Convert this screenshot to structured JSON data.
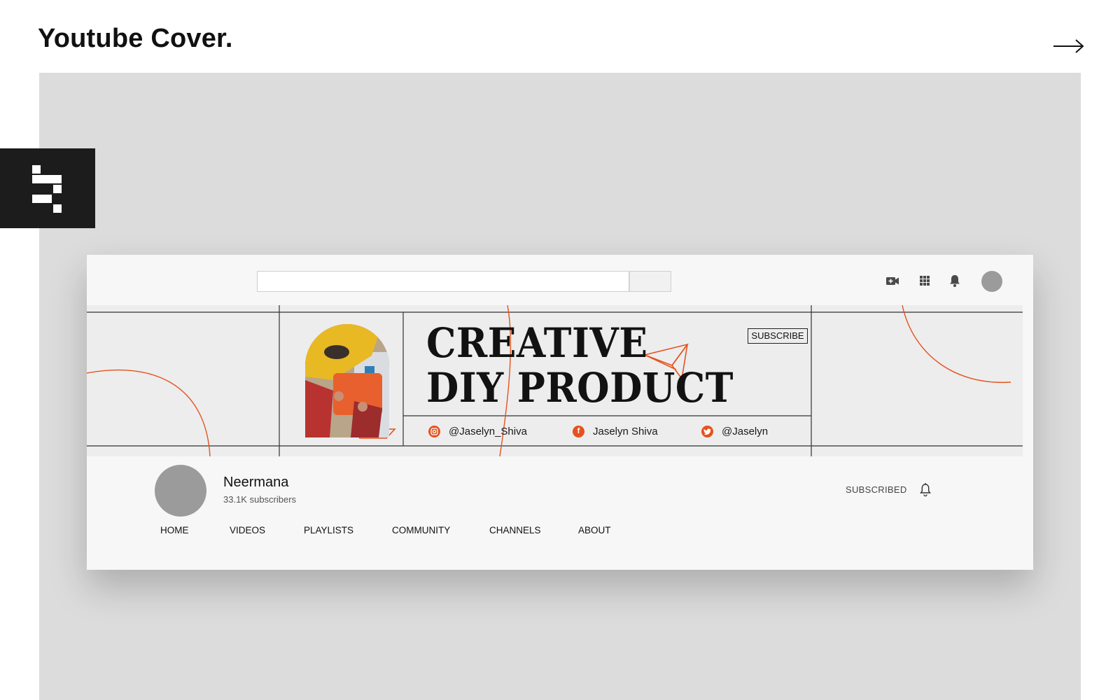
{
  "page": {
    "title": "Youtube Cover."
  },
  "brand": {
    "logo_icon": "pixel-logo-icon"
  },
  "youtube": {
    "search": {
      "placeholder": ""
    },
    "top_icons": [
      "video-camera-plus-icon",
      "apps-grid-icon",
      "notification-bell-icon"
    ],
    "banner": {
      "title_line1": "CREATIVE",
      "title_line2": "DIY PRODUCT",
      "subscribe_badge": "SUBSCRIBE",
      "socials": [
        {
          "platform": "instagram",
          "icon": "instagram-icon",
          "handle": "@Jaselyn_Shiva"
        },
        {
          "platform": "facebook",
          "icon": "facebook-icon",
          "handle": "Jaselyn Shiva"
        },
        {
          "platform": "twitter",
          "icon": "twitter-icon",
          "handle": "@Jaselyn"
        }
      ],
      "accent_color": "#e5521e"
    },
    "channel": {
      "name": "Neermana",
      "subscribers": "33.1K subscribers",
      "subscribed_label": "SUBSCRIBED"
    },
    "tabs": [
      "HOME",
      "VIDEOS",
      "PLAYLISTS",
      "COMMUNITY",
      "CHANNELS",
      "ABOUT"
    ]
  },
  "colors": {
    "background": "#dcdcdc",
    "frame": "#f7f7f7",
    "banner": "#ededed",
    "accent": "#e5521e",
    "dark": "#1c1c1c"
  }
}
